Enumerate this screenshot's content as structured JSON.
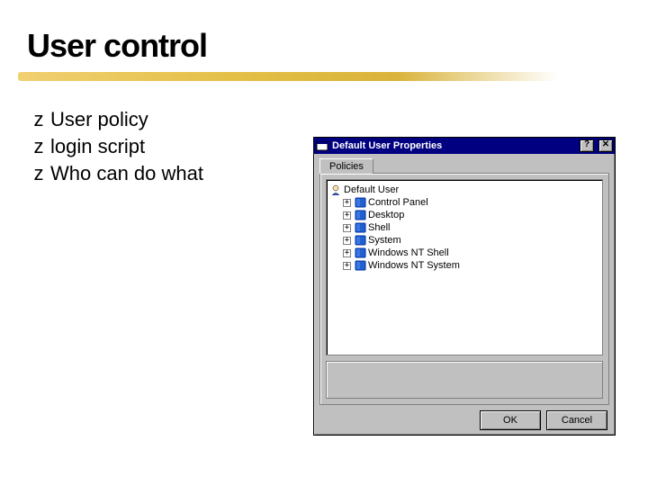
{
  "title": "User control",
  "bullets": [
    "User policy",
    "login script",
    "Who can do what"
  ],
  "dialog": {
    "title": "Default User Properties",
    "help_btn": "?",
    "close_btn": "✕",
    "tab": "Policies",
    "tree": {
      "root": "Default User",
      "children": [
        "Control Panel",
        "Desktop",
        "Shell",
        "System",
        "Windows NT Shell",
        "Windows NT System"
      ]
    },
    "ok": "OK",
    "cancel": "Cancel"
  }
}
